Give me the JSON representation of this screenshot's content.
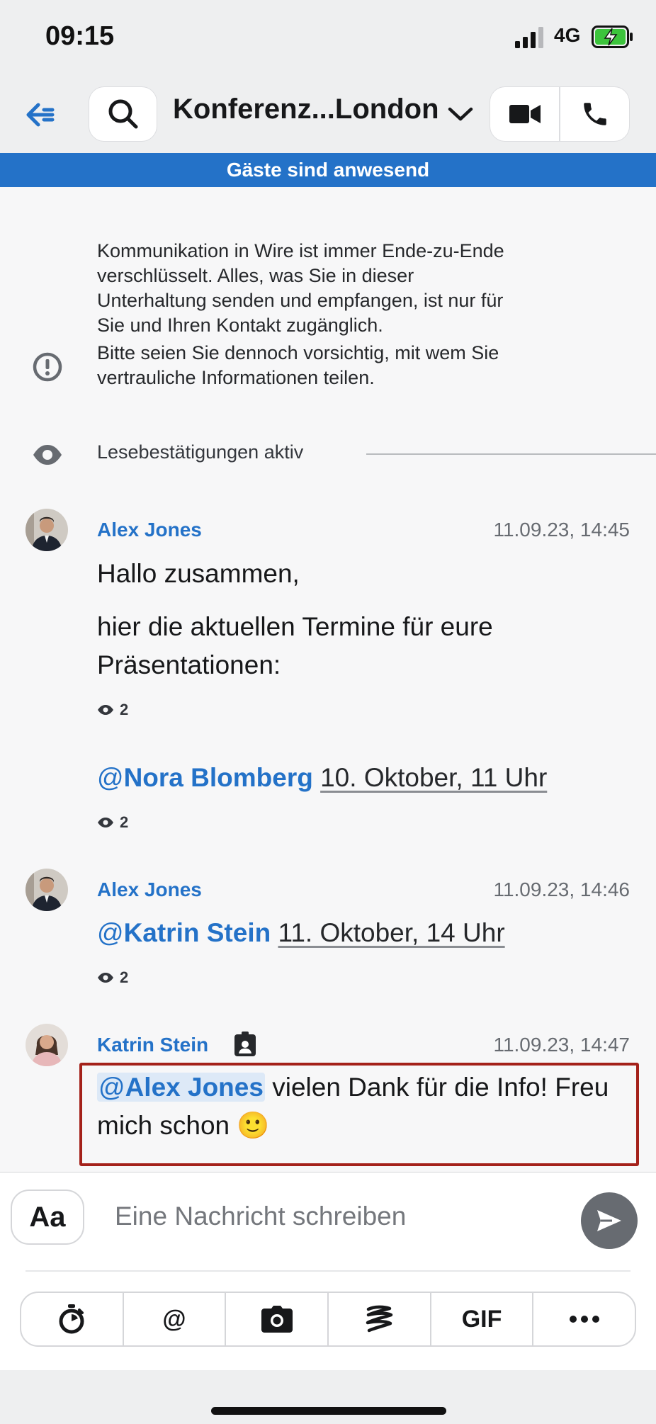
{
  "status_bar": {
    "time": "09:15",
    "network": "4G"
  },
  "header": {
    "title": "Konferenz...London"
  },
  "banner": {
    "text": "Gäste sind anwesend"
  },
  "system": {
    "encryption_lines": [
      "Kommunikation in Wire ist immer Ende-zu-Ende",
      "verschlüsselt. Alles, was Sie in dieser",
      "Unterhaltung senden und empfangen, ist nur für",
      "Sie und Ihren Kontakt zugänglich.",
      "Bitte seien Sie dennoch vorsichtig, mit wem Sie",
      "vertrauliche Informationen teilen."
    ],
    "read_receipts": "Lesebestätigungen aktiv"
  },
  "messages": [
    {
      "sender": "Alex Jones",
      "time": "11.09.23, 14:45",
      "line1": "Hallo zusammen,",
      "line2": "hier die aktuellen Termine für eure Präsentationen:",
      "seen_count": "2"
    },
    {
      "at": "@",
      "mention": "Nora Blomberg",
      "date": "10. Oktober, 11 Uhr",
      "seen_count": "2"
    },
    {
      "sender": "Alex Jones",
      "time": "11.09.23, 14:46",
      "at": "@",
      "mention": "Katrin Stein",
      "date": "11. Oktober, 14 Uhr",
      "seen_count": "2"
    },
    {
      "sender": "Katrin Stein",
      "time": "11.09.23, 14:47",
      "at": "@",
      "mention": "Alex Jones",
      "text": " vielen Dank für die Info! Freu mich schon ",
      "emoji": "🙂"
    }
  ],
  "composer": {
    "format_label": "Aa",
    "placeholder": "Eine Nachricht schreiben",
    "tools": {
      "mention": "@",
      "gif": "GIF"
    }
  },
  "colors": {
    "accent": "#2472c8",
    "highlight_border": "#a4211a"
  }
}
